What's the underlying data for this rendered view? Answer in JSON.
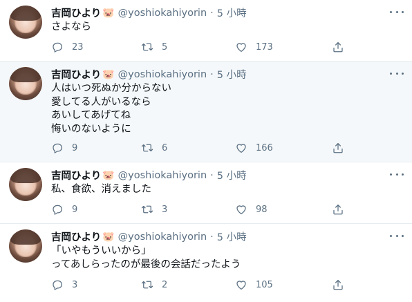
{
  "tweets": [
    {
      "name": "吉岡ひより",
      "emoji": "🐷",
      "handle": "@yoshiokahiyorin",
      "time": "5 小時",
      "lines": [
        "さよなら"
      ],
      "replies": "23",
      "retweets": "5",
      "likes": "173"
    },
    {
      "name": "吉岡ひより",
      "emoji": "🐷",
      "handle": "@yoshiokahiyorin",
      "time": "5 小時",
      "lines": [
        "人はいつ死ぬか分からない",
        "愛してる人がいるなら",
        "あいしてあげてね",
        "悔いのないように"
      ],
      "replies": "9",
      "retweets": "6",
      "likes": "166"
    },
    {
      "name": "吉岡ひより",
      "emoji": "🐷",
      "handle": "@yoshiokahiyorin",
      "time": "5 小時",
      "lines": [
        "私、食欲、消えました"
      ],
      "replies": "9",
      "retweets": "3",
      "likes": "98"
    },
    {
      "name": "吉岡ひより",
      "emoji": "🐷",
      "handle": "@yoshiokahiyorin",
      "time": "5 小時",
      "lines": [
        "「いやもういいから」",
        "ってあしらったのが最後の会話だったよう"
      ],
      "replies": "3",
      "retweets": "2",
      "likes": "105"
    }
  ],
  "separator": "·",
  "colors": {
    "text": "#0f1419",
    "secondary": "#5b7083",
    "border": "#e6ecf0",
    "hover_bg": "#f5f8fa"
  },
  "icons": {
    "reply": "reply-icon",
    "retweet": "retweet-icon",
    "like": "heart-icon",
    "share": "share-icon",
    "more": "more-icon"
  }
}
